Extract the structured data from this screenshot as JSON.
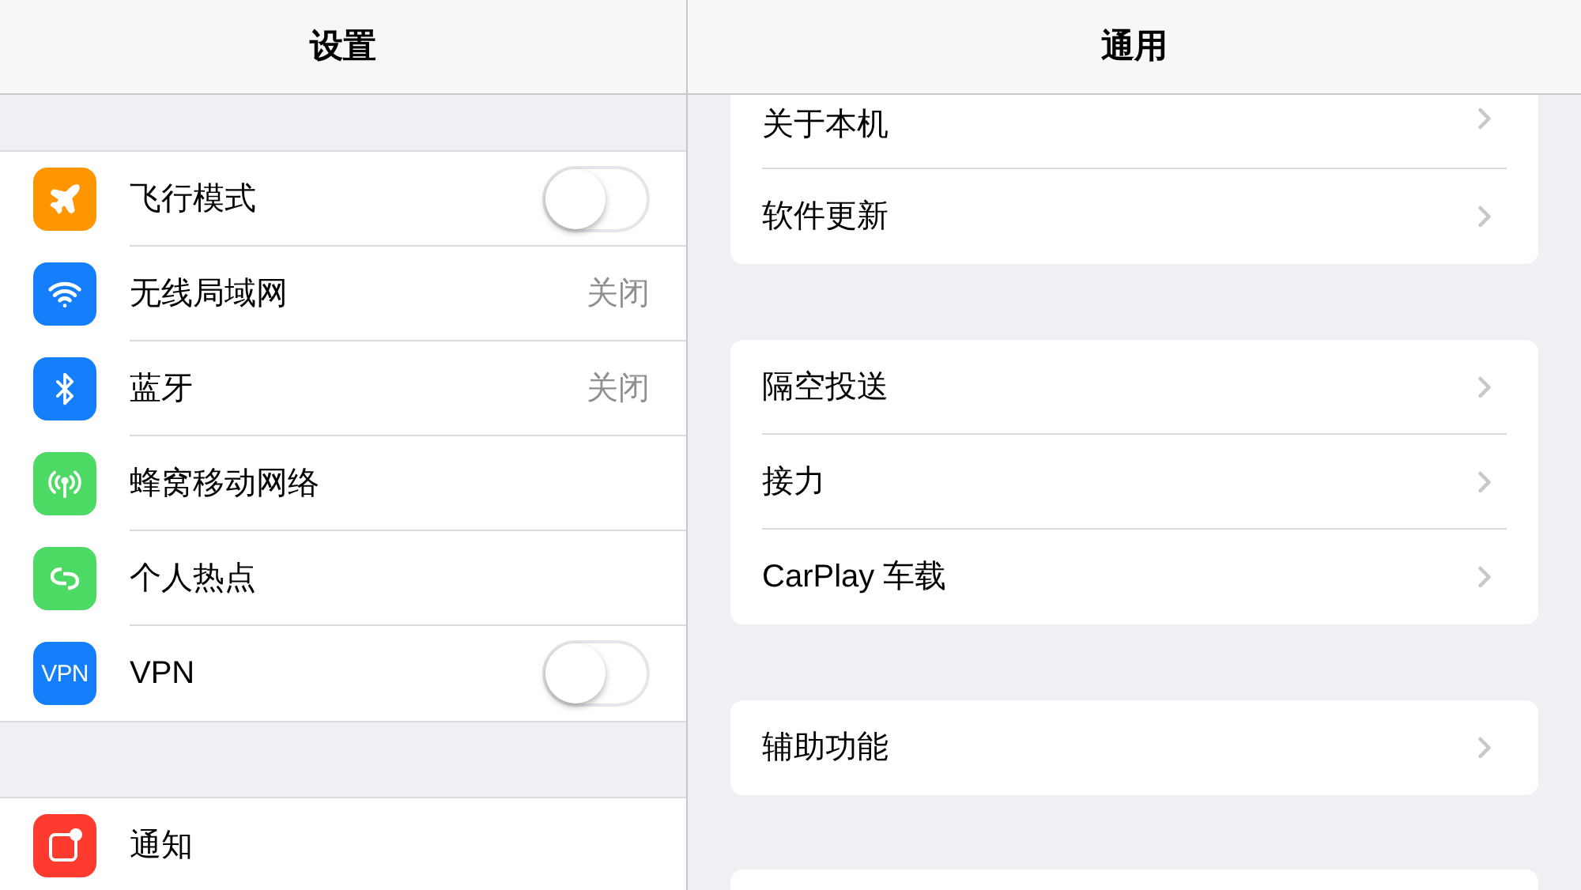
{
  "master": {
    "title": "设置",
    "groups": [
      [
        {
          "label": "飞行模式",
          "kind": "toggle",
          "on": false,
          "color": "#ff9500"
        },
        {
          "label": "无线局域网",
          "kind": "value",
          "value": "关闭",
          "color": "#147efb"
        },
        {
          "label": "蓝牙",
          "kind": "value",
          "value": "关闭",
          "color": "#147efb"
        },
        {
          "label": "蜂窝移动网络",
          "kind": "plain",
          "color": "#4cd964"
        },
        {
          "label": "个人热点",
          "kind": "plain",
          "color": "#4cd964"
        },
        {
          "label": "VPN",
          "kind": "toggle",
          "on": false,
          "color": "#147efb",
          "badge": "VPN"
        }
      ],
      [
        {
          "label": "通知",
          "kind": "plain",
          "color": "#ff3b30"
        }
      ]
    ]
  },
  "detail": {
    "title": "通用",
    "groups": [
      [
        "关于本机",
        "软件更新"
      ],
      [
        "隔空投送",
        "接力",
        "CarPlay 车载"
      ],
      [
        "辅助功能"
      ]
    ]
  }
}
